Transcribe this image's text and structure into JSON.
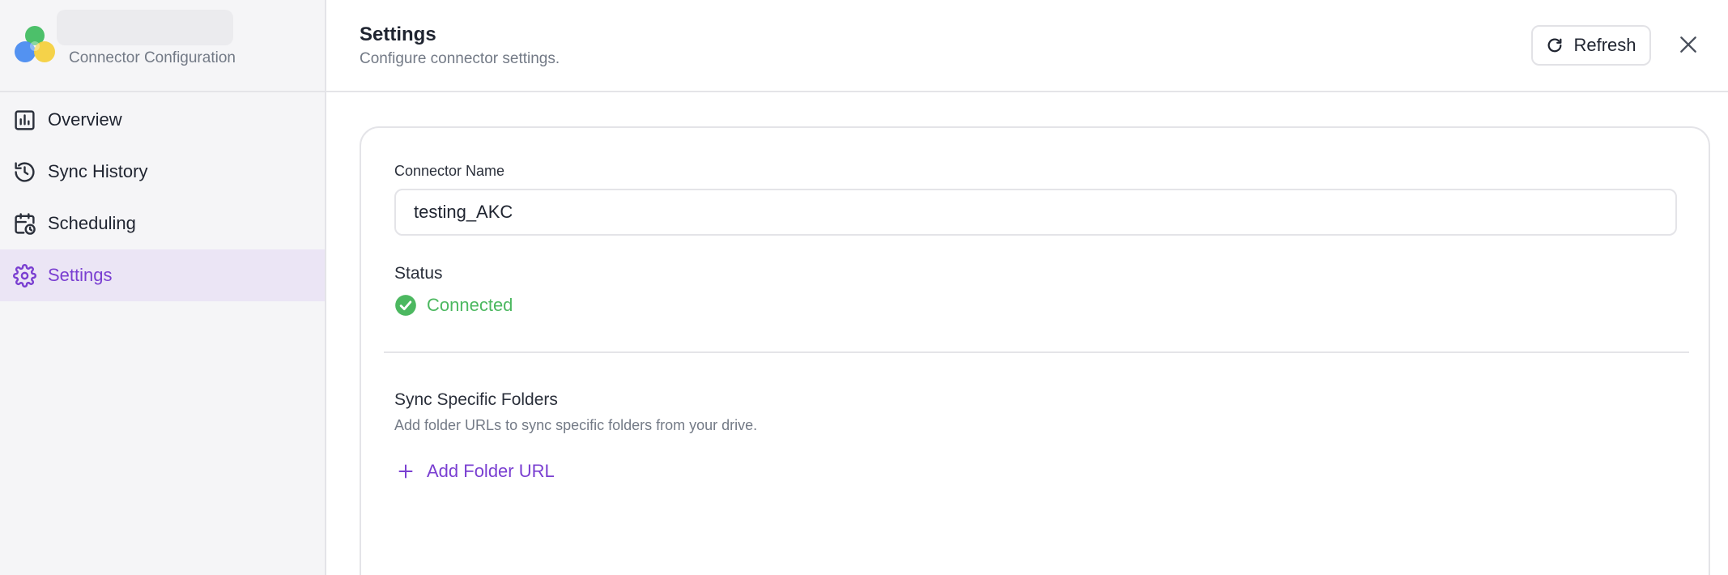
{
  "brand": {
    "subtitle": "Connector Configuration"
  },
  "sidebar": {
    "items": [
      {
        "label": "Overview",
        "icon": "chart-icon"
      },
      {
        "label": "Sync History",
        "icon": "history-icon"
      },
      {
        "label": "Scheduling",
        "icon": "calendar-clock-icon"
      },
      {
        "label": "Settings",
        "icon": "gear-icon",
        "active": true
      }
    ]
  },
  "header": {
    "title": "Settings",
    "subtitle": "Configure connector settings.",
    "refresh_label": "Refresh"
  },
  "form": {
    "connector_name_label": "Connector Name",
    "connector_name_value": "testing_AKC",
    "status_label": "Status",
    "status_value": "Connected",
    "folders_title": "Sync Specific Folders",
    "folders_desc": "Add folder URLs to sync specific folders from your drive.",
    "add_folder_label": "Add Folder URL"
  },
  "colors": {
    "accent": "#7a3fd1",
    "active_bg": "#ebe5f5",
    "success": "#4cb860"
  }
}
